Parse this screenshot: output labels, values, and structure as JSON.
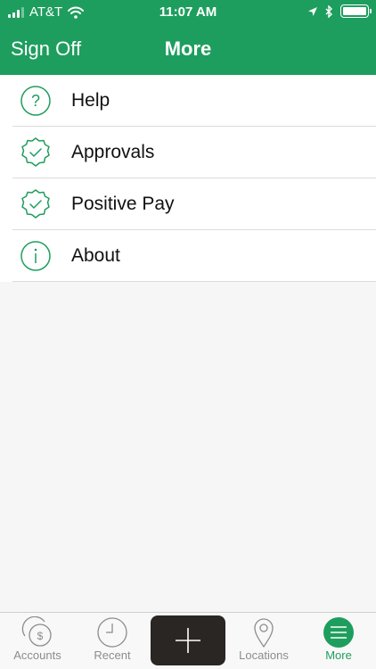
{
  "status_bar": {
    "carrier": "AT&T",
    "time": "11:07 AM"
  },
  "nav": {
    "back_label": "Sign Off",
    "title": "More"
  },
  "menu": {
    "items": [
      {
        "label": "Help",
        "icon": "question-circle-icon"
      },
      {
        "label": "Approvals",
        "icon": "check-badge-icon"
      },
      {
        "label": "Positive Pay",
        "icon": "check-badge-icon"
      },
      {
        "label": "About",
        "icon": "info-circle-icon"
      }
    ]
  },
  "tab_bar": {
    "tabs": [
      {
        "label": "Accounts",
        "icon": "accounts-dollar-icon"
      },
      {
        "label": "Recent",
        "icon": "clock-icon"
      },
      {
        "label": "",
        "icon": "plus-icon"
      },
      {
        "label": "Locations",
        "icon": "location-pin-icon"
      },
      {
        "label": "More",
        "icon": "menu-icon"
      }
    ],
    "active": "More"
  },
  "colors": {
    "brand_green": "#1e9e5e",
    "add_button": "#2a2624",
    "inactive_tab": "#8c8c8c"
  }
}
